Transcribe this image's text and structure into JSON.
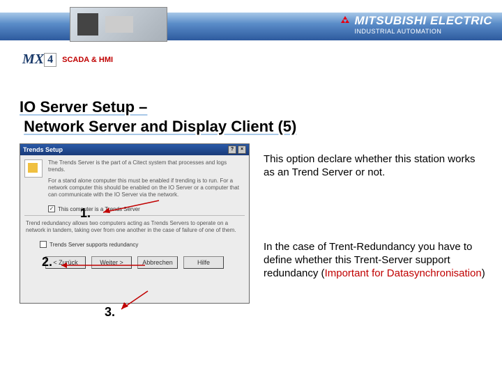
{
  "brand": {
    "name": "MITSUBISHI ELECTRIC",
    "sub": "INDUSTRIAL AUTOMATION"
  },
  "subheader": {
    "logo": "MX",
    "logo_num": "4",
    "label": "SCADA & HMI"
  },
  "title": {
    "line1": "IO Server Setup –",
    "line2": "Network Server and Display Client (5)"
  },
  "dialog": {
    "title": "Trends Setup",
    "intro": "The Trends Server is the part of a Citect system that processes and logs trends.",
    "para": "For a stand alone computer this must be enabled if trending is to run. For a network computer this should be enabled on the IO Server or a computer that can communicate with the IO Server via the network.",
    "cb1": "This computer is a Trends Server",
    "mid": "Trend redundancy allows two computers acting as Trends Servers to operate on a network in tandem, taking over from one another in the case of failure of one of them.",
    "cb2": "Trends Server supports redundancy",
    "buttons": {
      "back": "< Zurück",
      "next": "Weiter >",
      "cancel": "Abbrechen",
      "help": "Hilfe"
    },
    "checked": "✓"
  },
  "markers": {
    "m1": "1.",
    "m2": "2.",
    "m3": "3."
  },
  "notes": {
    "p1": "This option declare whether this station works as an Trend Server or not.",
    "p2a": "In the case of Trent-Redundancy you have to define whether this Trent-Server support redundancy (",
    "p2b": "Important for Datasynchronisation",
    "p2c": ")"
  }
}
